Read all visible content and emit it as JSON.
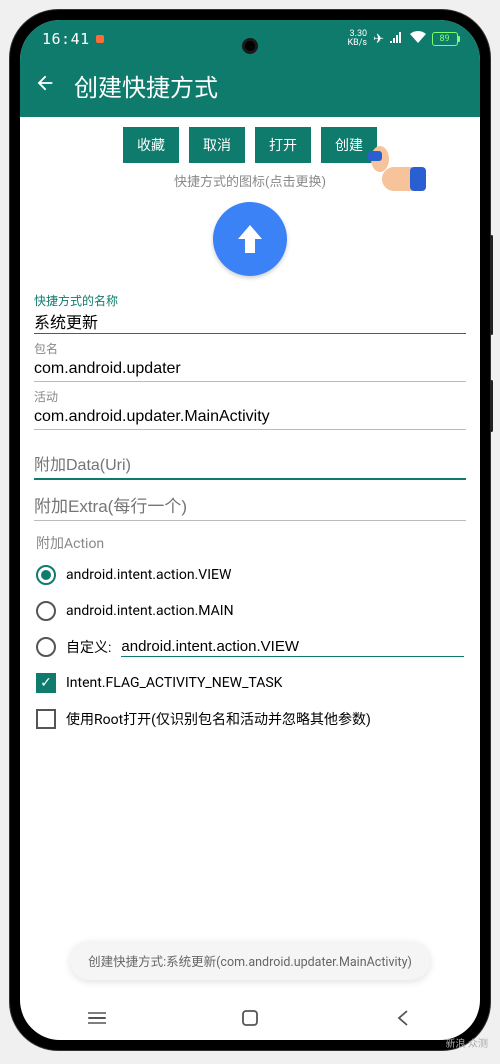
{
  "status": {
    "time": "16:41",
    "net_speed_top": "3.30",
    "net_speed_bottom": "KB/s",
    "battery": "89"
  },
  "header": {
    "title": "创建快捷方式"
  },
  "actions": {
    "favorite": "收藏",
    "cancel": "取消",
    "open": "打开",
    "create": "创建"
  },
  "icon_caption": "快捷方式的图标(点击更换)",
  "fields": {
    "name_label": "快捷方式的名称",
    "name_value": "系统更新",
    "package_label": "包名",
    "package_value": "com.android.updater",
    "activity_label": "活动",
    "activity_value": "com.android.updater.MainActivity",
    "data_placeholder": "附加Data(Uri)",
    "extra_placeholder": "附加Extra(每行一个)"
  },
  "action_section": {
    "title": "附加Action",
    "view": "android.intent.action.VIEW",
    "main": "android.intent.action.MAIN",
    "custom_label": "自定义:",
    "custom_value": "android.intent.action.VIEW",
    "flag_new_task": "Intent.FLAG_ACTIVITY_NEW_TASK",
    "use_root": "使用Root打开(仅识别包名和活动并忽略其他参数)"
  },
  "toast": "创建快捷方式:系统更新(com.android.updater.MainActivity)",
  "watermark": "新浪\n众测"
}
